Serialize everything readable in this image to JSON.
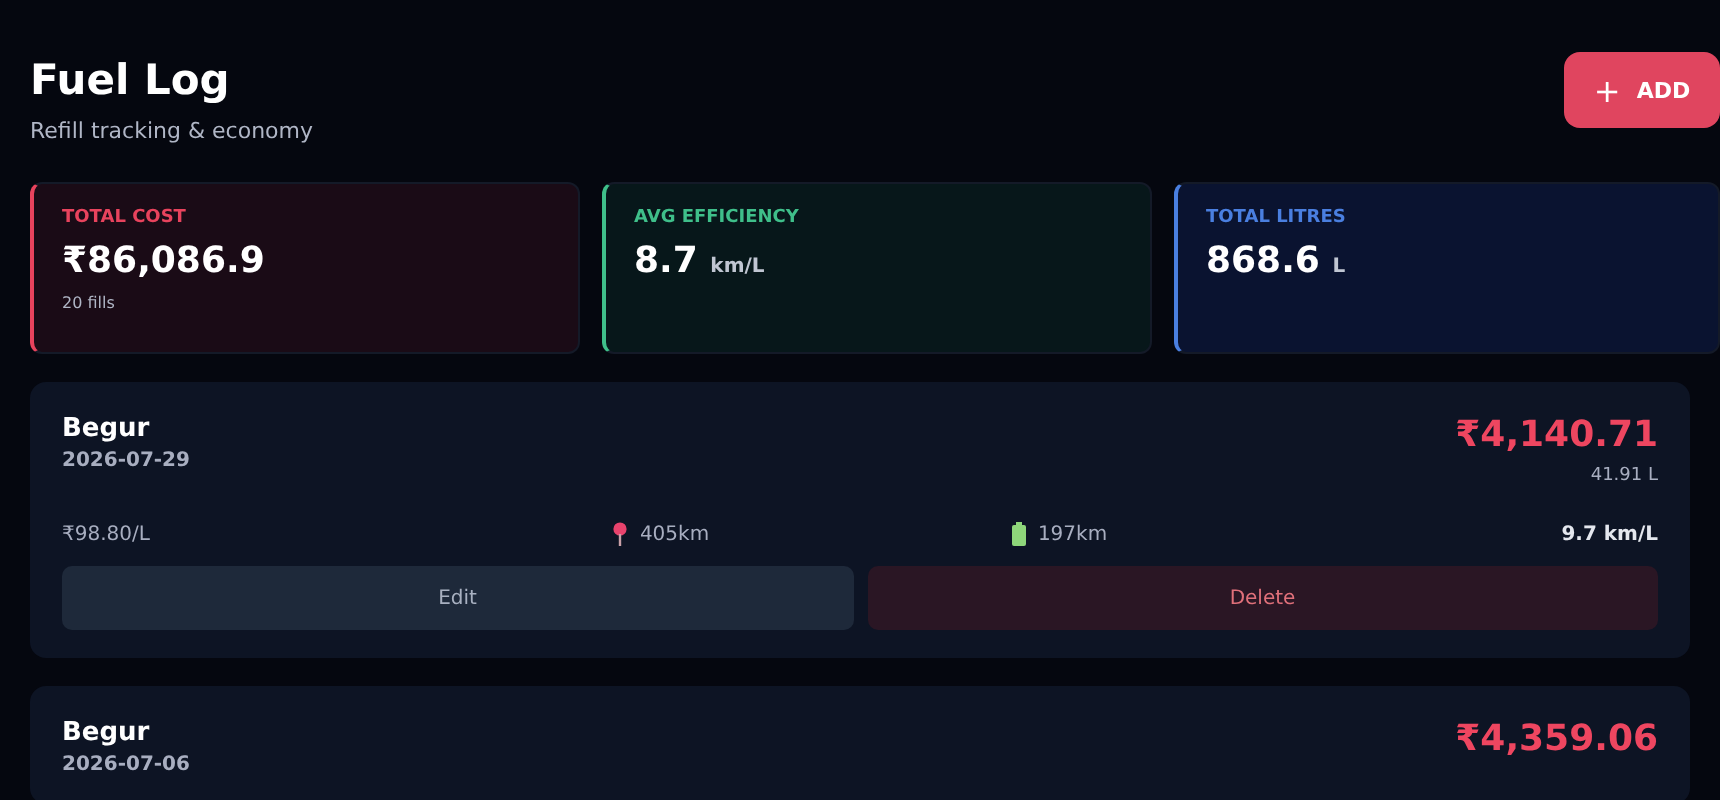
{
  "header": {
    "title": "Fuel Log",
    "subtitle": "Refill tracking & economy",
    "add_button": {
      "icon": "+",
      "label": "ADD"
    }
  },
  "stats": [
    {
      "label": "TOTAL COST",
      "value": "₹86,086.9",
      "note": "20 fills",
      "color": "#e8435d"
    },
    {
      "label": "AVG EFFICIENCY",
      "value": "8.7",
      "unit": "km/L",
      "color": "#3fbf8a"
    },
    {
      "label": "TOTAL LITRES",
      "value": "868.6",
      "unit": "L",
      "color": "#4a7fe0"
    }
  ],
  "entries": [
    {
      "station": "Begur",
      "date": "2026-07-29",
      "cost": "₹4,140.71",
      "litres": "41.91 L",
      "price": "₹98.80/L",
      "odometer": "405km",
      "range": "197km",
      "efficiency": "9.7 km/L",
      "actions": [
        "Edit",
        "Delete"
      ]
    },
    {
      "station": "Begur",
      "date": "2026-07-06",
      "cost": "₹4,359.06"
    }
  ]
}
